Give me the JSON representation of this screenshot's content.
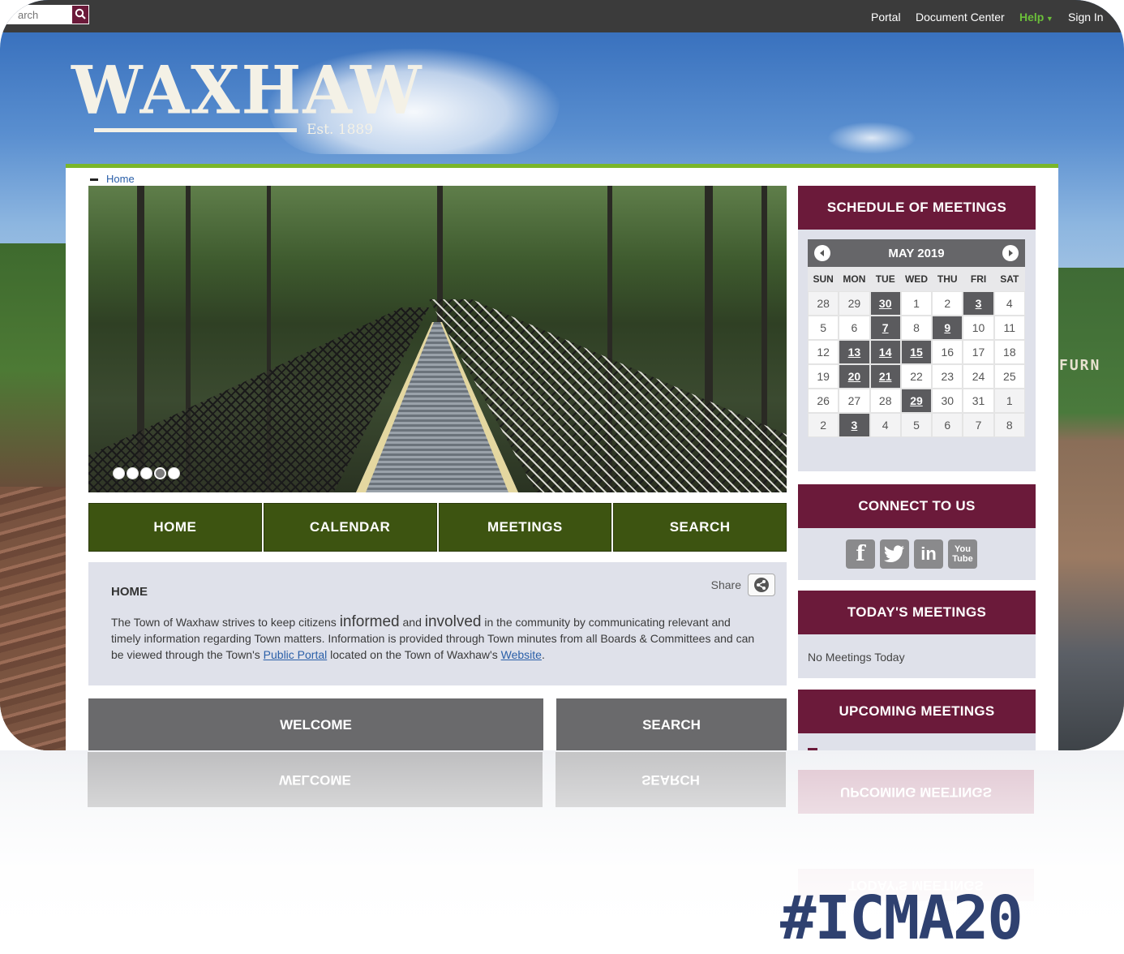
{
  "topbar": {
    "search_placeholder": "arch",
    "links": [
      "Portal",
      "Document Center",
      "Help",
      "Sign In"
    ]
  },
  "logo": {
    "name": "WAXHAW",
    "est": "Est. 1889"
  },
  "breadcrumb": {
    "home": "Home"
  },
  "slideshow": {
    "dot_count": 5,
    "active_dot": 4
  },
  "nav": {
    "home": "HOME",
    "calendar": "CALENDAR",
    "meetings": "MEETINGS",
    "search": "SEARCH"
  },
  "home": {
    "title": "HOME",
    "share": "Share",
    "text_1": "The Town of Waxhaw strives to keep citizens ",
    "word_informed": "informed",
    "text_and": " and ",
    "word_involved": "involved",
    "text_2": " in the community by communicating relevant and timely information regarding Town matters.  Information is provided through Town minutes from all Boards & Committees and can be viewed through the Town's ",
    "link_portal": "Public Portal",
    "text_3": " located on the Town of Waxhaw's ",
    "link_website": "Website",
    "text_4": "."
  },
  "tiles": {
    "welcome": "WELCOME",
    "search": "SEARCH"
  },
  "sidebar": {
    "schedule": "SCHEDULE OF MEETINGS",
    "connect": "CONNECT TO US",
    "today": "TODAY'S MEETINGS",
    "no_meetings": "No Meetings Today",
    "upcoming": "UPCOMING MEETINGS"
  },
  "calendar": {
    "title": "MAY 2019",
    "days": [
      "SUN",
      "MON",
      "TUE",
      "WED",
      "THU",
      "FRI",
      "SAT"
    ],
    "weeks": [
      [
        "28",
        "29",
        "30",
        "1",
        "2",
        "3",
        "4"
      ],
      [
        "5",
        "6",
        "7",
        "8",
        "9",
        "10",
        "11"
      ],
      [
        "12",
        "13",
        "14",
        "15",
        "16",
        "17",
        "18"
      ],
      [
        "19",
        "20",
        "21",
        "22",
        "23",
        "24",
        "25"
      ],
      [
        "26",
        "27",
        "28",
        "29",
        "30",
        "31",
        "1"
      ],
      [
        "2",
        "3",
        "4",
        "5",
        "6",
        "7",
        "8"
      ]
    ],
    "meeting_cells": [
      "0-2",
      "0-5",
      "1-2",
      "1-4",
      "2-1",
      "2-2",
      "2-3",
      "3-1",
      "3-2",
      "4-3",
      "5-1"
    ],
    "other_month_cells": [
      "0-0",
      "0-1",
      "4-6",
      "5-0",
      "5-1",
      "5-2",
      "5-3",
      "5-4",
      "5-5",
      "5-6"
    ]
  },
  "social": [
    "facebook-icon",
    "twitter-icon",
    "linkedin-icon",
    "youtube-icon"
  ],
  "decor": {
    "hashtag": "#ICMA20",
    "building_sign": "FURN"
  },
  "colors": {
    "maroon": "#6b1a3a",
    "olive": "#3d5411",
    "green_accent": "#7ab62a",
    "gray_tile": "#6a6a6c",
    "topbar": "#3b3b3b"
  }
}
